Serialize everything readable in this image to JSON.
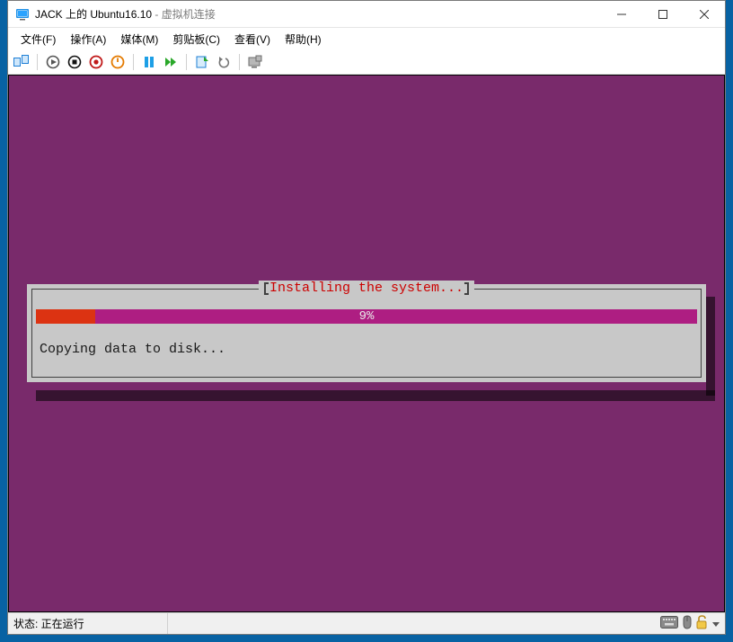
{
  "window": {
    "title_primary": "JACK 上的 Ubuntu16.10",
    "title_separator": " - ",
    "title_secondary": "虚拟机连接"
  },
  "menu": {
    "file": "文件(F)",
    "action": "操作(A)",
    "media": "媒体(M)",
    "clipboard": "剪贴板(C)",
    "view": "查看(V)",
    "help": "帮助(H)"
  },
  "installer": {
    "title": "Installing the system...",
    "progress_percent": 9,
    "progress_label": "9%",
    "status_text": "Copying data to disk..."
  },
  "status": {
    "label": "状态: 正在运行"
  },
  "colors": {
    "guest_bg": "#792a6b",
    "progress_fill": "#dc3312",
    "progress_track": "#ae1e82",
    "installer_title": "#cc0000"
  }
}
